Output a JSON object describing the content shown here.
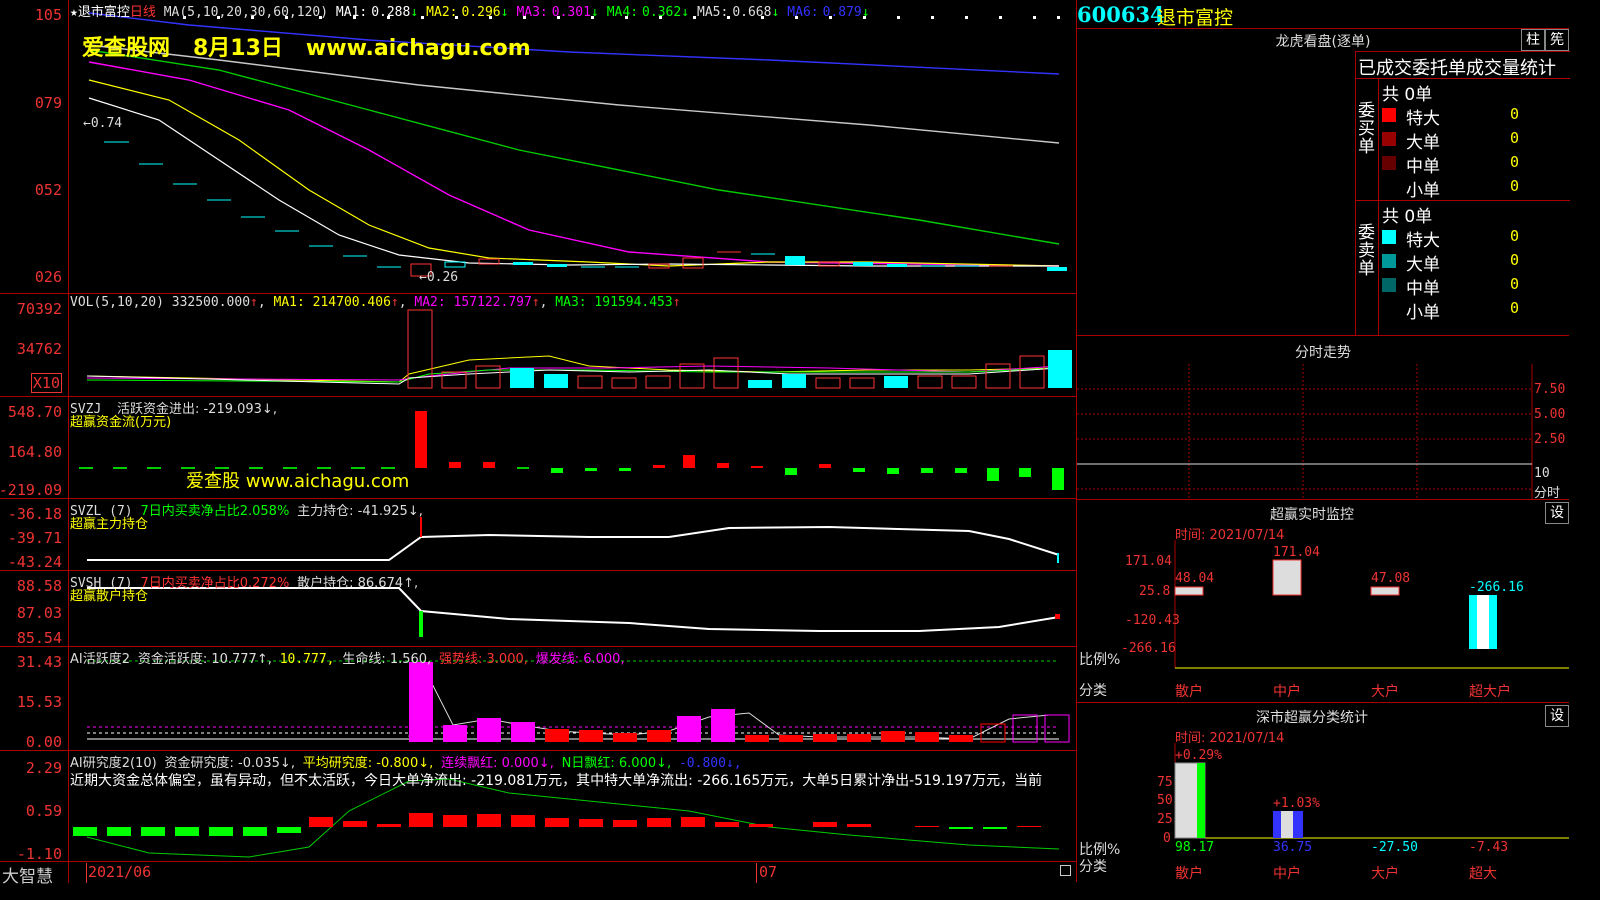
{
  "header": {
    "star": "★",
    "name": "退市富控",
    "period": "日线",
    "ma_title": "MA(5,10,20,30,60,120)",
    "mas": [
      {
        "label": "MA1:",
        "value": "0.288",
        "arrow": "↓",
        "color": "#ffffff"
      },
      {
        "label": "MA2:",
        "value": "0.296",
        "arrow": "↓",
        "color": "#ffff00"
      },
      {
        "label": "MA3:",
        "value": "0.301",
        "arrow": "↓",
        "color": "#ff00ff"
      },
      {
        "label": "MA4:",
        "value": "0.362",
        "arrow": "↓",
        "color": "#00ff00"
      },
      {
        "label": "MA5:",
        "value": "0.668",
        "arrow": "↓",
        "color": "#dddddd"
      },
      {
        "label": "MA6:",
        "value": "0.879",
        "arrow": "↓",
        "color": "#3333ff"
      }
    ]
  },
  "watermark": {
    "site": "爱查股网",
    "date": "8月13日",
    "url": "www.aichagu.com",
    "bottom": "爱查股 www.aichagu.com"
  },
  "price_panel": {
    "yticks": [
      "105",
      "079",
      "052",
      "026"
    ],
    "high_mark": "←0.74",
    "low_mark": "←0.26"
  },
  "vol_panel": {
    "title": "VOL(5,10,20)",
    "value": "332500.000",
    "arrow": "↑",
    "ma1": "MA1: 214700.406",
    "ma2": "MA2: 157122.797",
    "ma3": "MA3: 191594.453",
    "yticks": [
      "70392",
      "34762"
    ],
    "unit": "X10"
  },
  "svzj_panel": {
    "title": "SVZJ",
    "label": "活跃资金进出: -219.093↓,",
    "sub": "超赢资金流(万元)",
    "yticks": [
      "548.70",
      "164.80",
      "-219.09"
    ]
  },
  "svzl_panel": {
    "title": "SVZL (7)",
    "ratio": "7日内买卖净占比2.058%",
    "hold": "主力持仓: -41.925↓,",
    "sub": "超赢主力持仓",
    "yticks": [
      "-36.18",
      "-39.71",
      "-43.24"
    ]
  },
  "svsh_panel": {
    "title": "SVSH (7)",
    "ratio": "7日内买卖净占比0.272%",
    "hold": "散户持仓: 86.674↑,",
    "sub": "超赢散户持仓",
    "yticks": [
      "88.58",
      "87.03",
      "85.54"
    ]
  },
  "ai_active_panel": {
    "title": "AI活跃度2",
    "v1": "资金活跃度: 10.777↑,",
    "v2": "10.777,",
    "v3": "生命线: 1.560,",
    "v4": "强势线: 3.000,",
    "v5": "爆发线: 6.000,",
    "yticks": [
      "31.43",
      "15.53",
      "0.00"
    ]
  },
  "ai_research_panel": {
    "title": "AI研究度2(10)",
    "v1": "资金研究度: -0.035↓,",
    "v2": "平均研究度: -0.800↓,",
    "v3": "连续飘红: 0.000↓,",
    "v4": "N日飘红: 6.000↓,",
    "v5": "-0.800↓,",
    "text": "近期大资金总体偏空，虽有异动，但不太活跃，今日大单净流出: -219.081万元，其中特大单净流出: -266.165万元，大单5日累计净出-519.197万元，当前",
    "yticks": [
      "2.29",
      "0.59",
      "-1.10"
    ]
  },
  "footer": {
    "brand": "大智慧",
    "date1": "2021/06",
    "date2": "07"
  },
  "right": {
    "code": "600634",
    "name": "退市富控",
    "dragon_title": "龙虎看盘(逐单)",
    "btn1": "柱",
    "btn2": "筅",
    "stat_title": "已成交委托单成交量统计",
    "buy": {
      "label": "委买单",
      "total": "共 0单",
      "rows": [
        {
          "name": "特大",
          "val": "0",
          "color": "#ff0000"
        },
        {
          "name": "大单",
          "val": "0",
          "color": "#990000"
        },
        {
          "name": "中单",
          "val": "0",
          "color": "#660000"
        },
        {
          "name": "小单",
          "val": "0",
          "color": "#000000"
        }
      ]
    },
    "sell": {
      "label": "委卖单",
      "total": "共 0单",
      "rows": [
        {
          "name": "特大",
          "val": "0",
          "color": "#00ffff"
        },
        {
          "name": "大单",
          "val": "0",
          "color": "#009999"
        },
        {
          "name": "中单",
          "val": "0",
          "color": "#006666"
        },
        {
          "name": "小单",
          "val": "0",
          "color": "#000000"
        }
      ]
    },
    "trend_title": "分时走势",
    "trend_ticks": [
      "7.50",
      "5.00",
      "2.50",
      "10"
    ],
    "trend_unit": "分时",
    "monitor_title": "超赢实时监控",
    "set": "设",
    "monitor_time": "时间: 2021/07/14",
    "monitor_yticks": [
      "171.04",
      "25.8",
      "-120.43",
      "-266.16"
    ],
    "monitor_bars": [
      {
        "cat": "散户",
        "v": "48.04"
      },
      {
        "cat": "中户",
        "v": "171.04"
      },
      {
        "cat": "大户",
        "v": "47.08"
      },
      {
        "cat": "超大户",
        "v": "-266.16"
      }
    ],
    "ratio_label": "比例%",
    "class_label": "分类",
    "stat2_title": "深市超赢分类统计",
    "stat2_time": "时间: 2021/07/14",
    "stat2_yticks": [
      "75",
      "50",
      "25",
      "0"
    ],
    "stat2_tops": [
      "+0.29%",
      "+1.03%"
    ],
    "stat2_vals": [
      {
        "cat": "散户",
        "v": "98.17"
      },
      {
        "cat": "中户",
        "v": "36.75"
      },
      {
        "cat": "大户",
        "v": "-27.50"
      },
      {
        "cat": "超大",
        "v": "-7.43"
      }
    ]
  }
}
